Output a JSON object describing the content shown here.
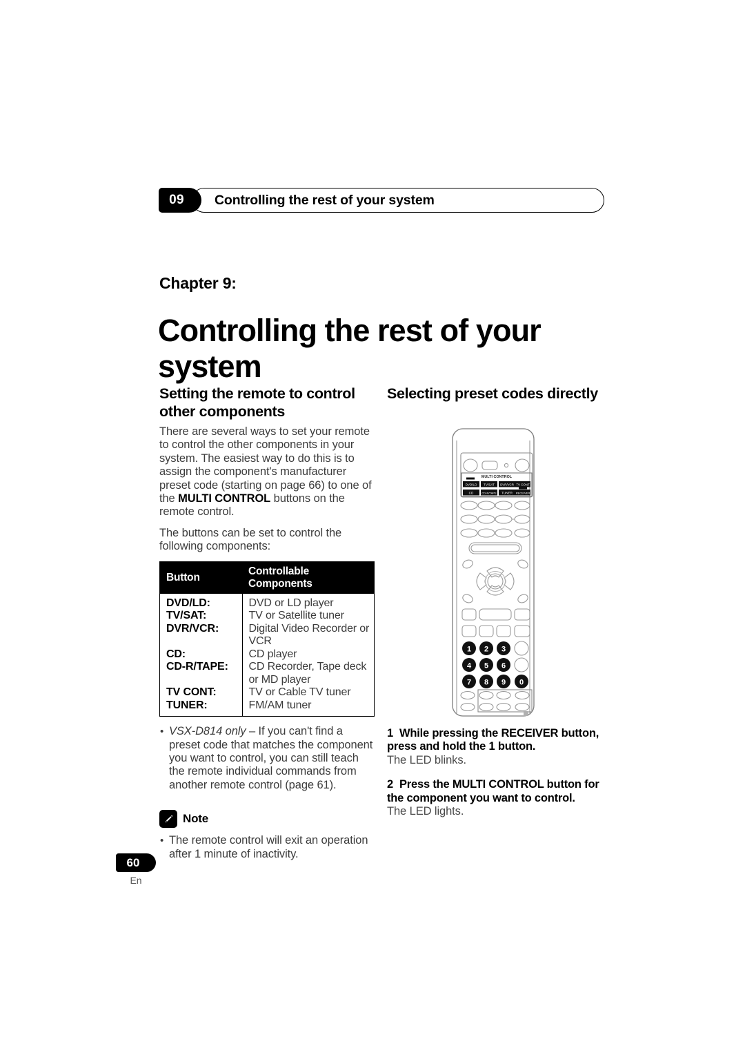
{
  "header": {
    "chapter_number": "09",
    "title": "Controlling the rest of your system"
  },
  "chapter": {
    "label": "Chapter 9:",
    "title": "Controlling the rest of your system"
  },
  "left_column": {
    "heading": "Setting the remote to control other components",
    "para1_part1": "There are several ways to set your remote to control the other components in your system. The easiest way to do this is to assign the component's manufacturer preset code (starting on page 66) to one of the ",
    "para1_bold1": "MULTI CONTROL",
    "para1_part2": " buttons on the remote control.",
    "para2": "The buttons can be set to control the following components:",
    "table": {
      "headers": [
        "Button",
        "Controllable Components"
      ],
      "rows": [
        {
          "button": "DVD/LD:",
          "components": "DVD or LD player"
        },
        {
          "button": "TV/SAT:",
          "components": "TV or Satellite tuner"
        },
        {
          "button": "DVR/VCR:",
          "components": "Digital Video Recorder or VCR"
        },
        {
          "button": "CD:",
          "components": "CD player"
        },
        {
          "button": "CD-R/TAPE:",
          "components": "CD Recorder, Tape deck or MD player"
        },
        {
          "button": "TV CONT:",
          "components": "TV or Cable TV tuner"
        },
        {
          "button": "TUNER:",
          "components": "FM/AM tuner"
        }
      ]
    },
    "bullet_italic": "VSX-D814 only",
    "bullet_text": " – If you can't find a preset code that matches the component you want to control, you can still teach the remote individual commands from another remote control (page 61).",
    "note_label": "Note",
    "note_bullet": "The remote control will exit an operation after 1 minute of inactivity."
  },
  "right_column": {
    "heading": "Selecting preset codes directly",
    "steps": [
      {
        "number": "1",
        "instruction": "While pressing the RECEIVER button, press and hold the 1 button.",
        "result": "The LED blinks."
      },
      {
        "number": "2",
        "instruction": "Press the MULTI CONTROL button for the component you want to control.",
        "result": "The LED lights."
      }
    ]
  },
  "remote": {
    "multi_control_label": "MULTI CONTROL",
    "buttons_row1": [
      "DVD/LD",
      "TV/SAT",
      "DVR/VCR",
      "TV CONT"
    ],
    "buttons_row2": [
      "CD",
      "CD-R/TAPE",
      "TUNER",
      "RECEIVER"
    ],
    "keypad": [
      "1",
      "2",
      "3",
      "4",
      "5",
      "6",
      "7",
      "8",
      "9",
      "0"
    ]
  },
  "footer": {
    "page_number": "60",
    "language": "En"
  }
}
